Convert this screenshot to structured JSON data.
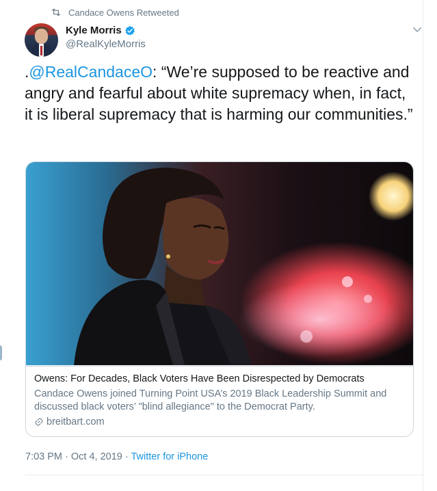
{
  "retweet": {
    "label": "Candace Owens Retweeted",
    "icon": "retweet-icon"
  },
  "author": {
    "display_name": "Kyle Morris",
    "handle": "@RealKyleMorris",
    "verified_icon": "verified-badge-icon"
  },
  "tweet": {
    "prefix": ".",
    "mention": "@RealCandaceO",
    "body": ": “We’re supposed to be reactive and angry and fearful about white supremacy when, in fact, it is liberal supremacy that is harming our communities.”"
  },
  "card": {
    "title": "Owens: For Decades, Black Voters Have Been Disrespected by Democrats",
    "description": "Candace Owens joined Turning Point USA’s 2019 Black Leadership Summit and discussed black voters’ \"blind allegiance\" to the Democrat Party.",
    "domain": "breitbart.com"
  },
  "meta": {
    "time": "7:03 PM · Oct 4, 2019",
    "separator": " · ",
    "source": "Twitter for iPhone"
  },
  "colors": {
    "accent": "#1b95e0",
    "secondary_text": "#657786",
    "border": "#ccd6dd"
  }
}
